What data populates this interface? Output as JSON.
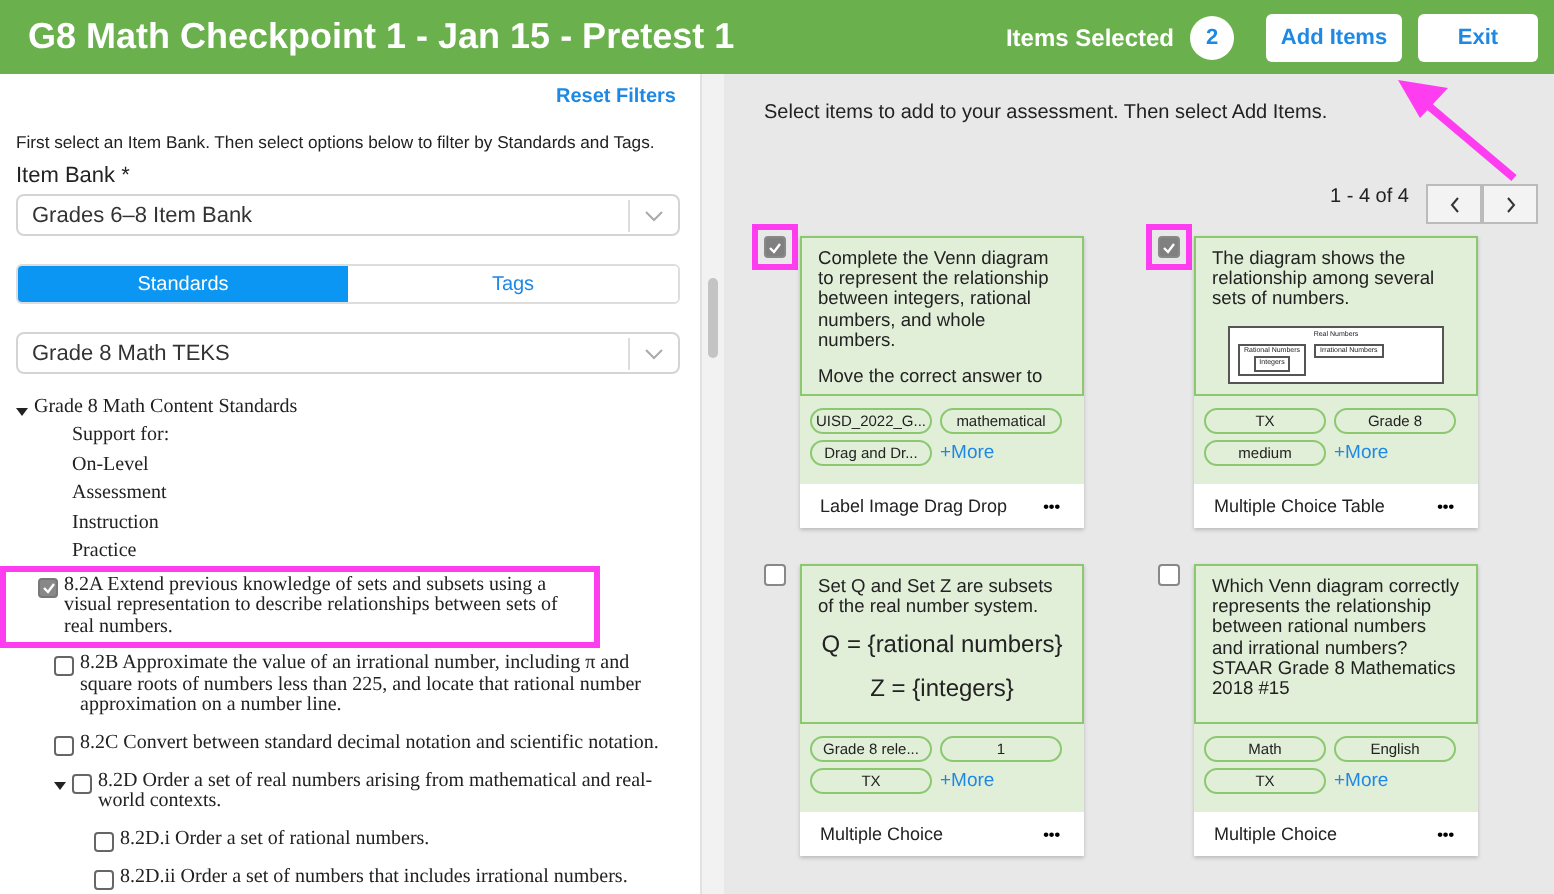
{
  "header": {
    "title": "G8 Math Checkpoint 1 - Jan 15 - Pretest 1",
    "items_selected_label": "Items Selected",
    "items_selected_count": "2",
    "buttons": [
      "Add Items",
      "Exit"
    ]
  },
  "filters": {
    "reset_link": "Reset Filters",
    "instructions": "First select an Item Bank. Then select options below to filter by Standards and Tags.",
    "item_bank_label": "Item Bank *",
    "item_bank_value": "Grades 6–8 Item Bank",
    "tabs": [
      {
        "label": "Standards",
        "selected": true
      },
      {
        "label": "Tags",
        "selected": false
      }
    ],
    "standard_set_value": "Grade 8 Math TEKS",
    "tree": [
      {
        "kind": "text",
        "label": "Grade 8 Math Content Standards",
        "expanded": true,
        "children": [
          {
            "kind": "text",
            "label": "Support for:"
          },
          {
            "kind": "text",
            "label": "On-Level"
          },
          {
            "kind": "text",
            "label": "Assessment"
          },
          {
            "kind": "text",
            "label": "Instruction"
          },
          {
            "kind": "text",
            "label": "Practice"
          },
          {
            "kind": "checkbox",
            "label": "8.2A Extend previous knowledge of sets and subsets using a visual representation to describe relationships between sets of real numbers.",
            "checked": true,
            "highlighted": true
          },
          {
            "kind": "checkbox",
            "label": "8.2B Approximate the value of an irrational number, including π and square roots of numbers less than 225, and locate that rational number approximation on a number line.",
            "checked": false,
            "highlighted": false
          },
          {
            "kind": "checkbox",
            "label": "8.2C Convert between standard decimal notation and scientific notation.",
            "checked": false,
            "highlighted": false
          },
          {
            "kind": "checkbox",
            "label": "8.2D Order a set of real numbers arising from mathematical and real-world contexts.",
            "checked": false,
            "highlighted": false,
            "expanded": true,
            "children": [
              {
                "kind": "checkbox",
                "label": "8.2D.i Order a set of rational numbers.",
                "checked": false,
                "highlighted": false
              },
              {
                "kind": "checkbox",
                "label": "8.2D.ii Order a set of numbers that includes irrational numbers.",
                "checked": false,
                "highlighted": false
              }
            ]
          }
        ]
      }
    ]
  },
  "results": {
    "instructions": "Select items to add to your assessment. Then select Add Items.",
    "pagination": "1 - 4 of 4",
    "pointer_arrow": true,
    "cards": [
      {
        "kind": "text",
        "checked": true,
        "highlighted": true,
        "prompt": [
          "Complete the Venn diagram to represent the relationship between integers, rational numbers, and whole numbers.",
          "Move the correct answer to"
        ],
        "tags": [
          "UISD_2022_G...",
          "mathematical",
          "Drag and Dr..."
        ],
        "more": "+More",
        "type": "Label Image Drag Drop",
        "menu": "•••"
      },
      {
        "kind": "diagram",
        "checked": true,
        "highlighted": true,
        "prompt": [
          "The diagram shows the relationship among several sets of numbers."
        ],
        "diagram": {
          "outer": "Real Numbers",
          "left": "Rational Numbers",
          "inner": "Integers",
          "right": "Irrational Numbers"
        },
        "tags": [
          "TX",
          "Grade 8",
          "medium"
        ],
        "more": "+More",
        "type": "Multiple Choice Table",
        "menu": "•••"
      },
      {
        "kind": "sets",
        "checked": false,
        "highlighted": false,
        "prompt": [
          "Set Q and Set Z are subsets of the real number system."
        ],
        "sets": [
          "Q = {rational numbers}",
          "Z = {integers}"
        ],
        "tags": [
          "Grade 8 rele...",
          "1",
          "TX"
        ],
        "more": "+More",
        "type": "Multiple Choice",
        "menu": "•••"
      },
      {
        "kind": "text",
        "checked": false,
        "highlighted": false,
        "prompt": [
          "Which Venn diagram correctly represents the relationship between rational numbers and irrational numbers?\nSTAAR Grade 8 Mathematics 2018 #15"
        ],
        "tags": [
          "Math",
          "English",
          "TX"
        ],
        "more": "+More",
        "type": "Multiple Choice",
        "menu": "•••"
      }
    ]
  }
}
